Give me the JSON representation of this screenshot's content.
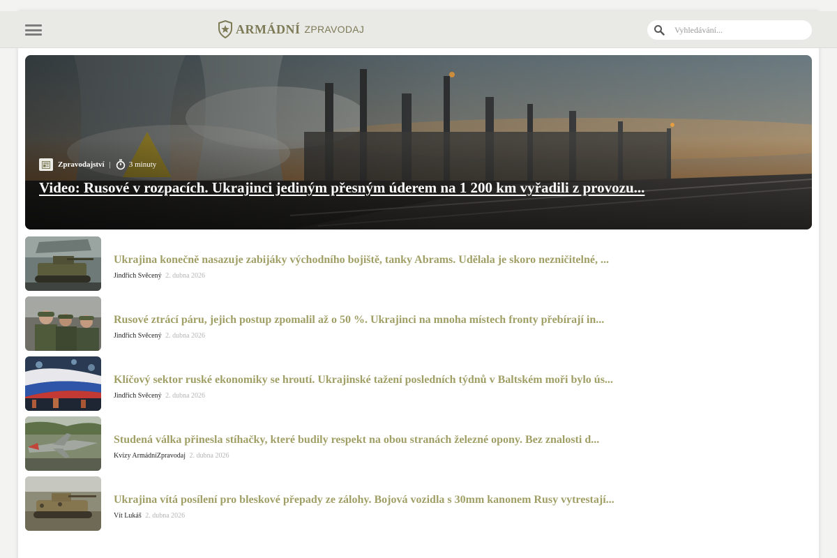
{
  "brand": {
    "logo_primary": "ARMÁDNÍ",
    "logo_secondary": "ZPRAVODAJ",
    "accent_color": "#7d7a56",
    "title_color": "#a09f66"
  },
  "header": {
    "menu_icon": "hamburger-menu-icon",
    "search": {
      "placeholder": "Vyhledávání...",
      "icon": "search-icon"
    }
  },
  "hero": {
    "category": "Zpravodajství",
    "category_icon": "newspaper-icon",
    "read_time": "3 minuty",
    "read_time_icon": "stopwatch-icon",
    "title": "Video: Rusové v rozpacích. Ukrajinci jediným přesným úderem na 1 200 km vyřadili z provozu..."
  },
  "articles": [
    {
      "title": "Ukrajina konečně nasazuje zabijáky východního bojiště, tanky Abrams. Udělala je skoro nezničitelné, ...",
      "author": "Jindřich Svěcený",
      "date": "2. dubna 2026"
    },
    {
      "title": "Rusové ztrácí páru, jejich postup zpomalil až o 50 %. Ukrajinci na mnoha místech fronty přebírají in...",
      "author": "Jindřich Svěcený",
      "date": "2. dubna 2026"
    },
    {
      "title": "Klíčový sektor ruské ekonomiky se hroutí. Ukrajinské tažení posledních týdnů v Baltském moři bylo ús...",
      "author": "Jindřich Svěcený",
      "date": "2. dubna 2026"
    },
    {
      "title": "Studená válka přinesla stíhačky, které budily respekt na obou stranách železné opony. Bez znalosti d...",
      "author": "Kvízy ArmádníZpravodaj",
      "date": "2. dubna 2026"
    },
    {
      "title": "Ukrajina vítá posílení pro bleskové přepady ze zálohy. Bojová vozidla s 30mm kanonem Rusy vytrestají...",
      "author": "Vít Lukáš",
      "date": "2. dubna 2026"
    }
  ]
}
